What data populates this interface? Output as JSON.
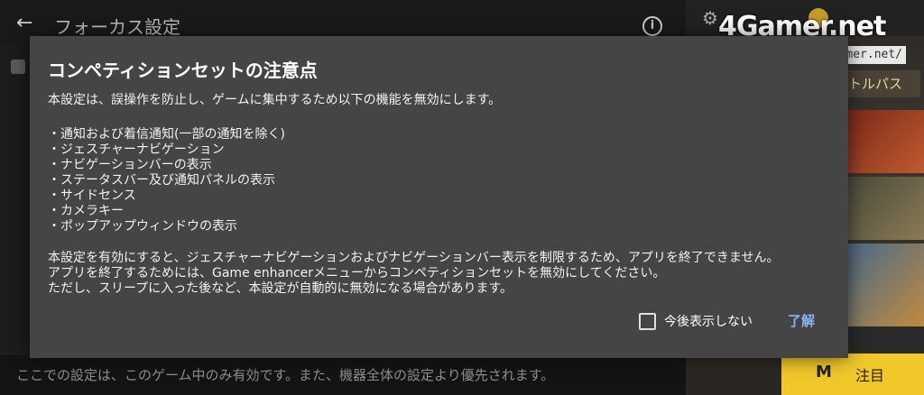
{
  "background": {
    "title": "フォーカス設定",
    "footer_text": "ここでの設定は、このゲーム中のみ有効です。また、機器全体の設定より優先されます。",
    "pass_label": "トルパス",
    "focus_button_label": "注目",
    "logo_text": "4Gamer.net",
    "logo_url": "https://www.4gamer.net/"
  },
  "dialog": {
    "title": "コンペティションセットの注意点",
    "intro": "本設定は、誤操作を防止し、ゲームに集中するため以下の機能を無効にします。",
    "items": [
      "・通知および着信通知(一部の通知を除く)",
      "・ジェスチャーナビゲーション",
      "・ナビゲーションバーの表示",
      "・ステータスバー及び通知パネルの表示",
      "・サイドセンス",
      "・カメラキー",
      "・ポップアップウィンドウの表示"
    ],
    "notes": [
      "本設定を有効にすると、ジェスチャーナビゲーションおよびナビゲーションバー表示を制限するため、アプリを終了できません。",
      "アプリを終了するためには、Game enhancerメニューからコンペティションセットを無効にしてください。",
      "ただし、スリープに入った後など、本設定が自動的に無効になる場合があります。"
    ],
    "checkbox_label": "今後表示しない",
    "checkbox_checked": false,
    "ok_label": "了解"
  }
}
